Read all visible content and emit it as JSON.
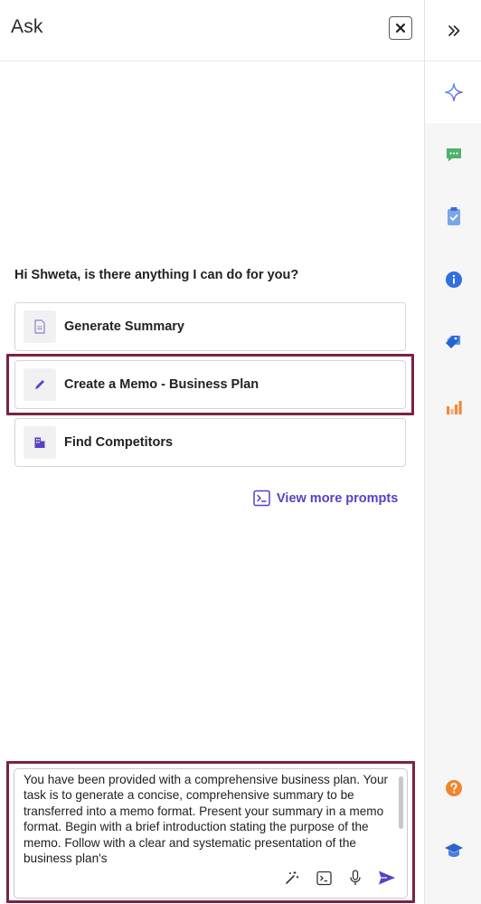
{
  "header": {
    "title": "Ask",
    "close_icon": "close-icon"
  },
  "greeting": "Hi Shweta, is there anything I can do for you?",
  "prompts": [
    {
      "label": "Generate Summary",
      "icon": "document-icon"
    },
    {
      "label": "Create a Memo - Business Plan",
      "icon": "pencil-icon"
    },
    {
      "label": "Find Competitors",
      "icon": "building-icon"
    }
  ],
  "view_more": {
    "label": "View more prompts",
    "icon": "terminal-prompt-icon"
  },
  "composer": {
    "text": "You have been provided with a comprehensive business plan. Your task is to generate a concise, comprehensive summary to be transferred into a memo format. Present your summary in a memo format. Begin with a brief introduction stating the purpose of the memo. Follow with a clear and systematic presentation of the business plan's",
    "tools": [
      "magic-wand-icon",
      "terminal-icon",
      "microphone-icon",
      "send-icon"
    ]
  },
  "rail": {
    "items": [
      "expand-icon",
      "sparkle-icon",
      "chat-icon",
      "clipboard-icon",
      "info-icon",
      "tag-icon",
      "bar-chart-icon",
      "help-icon",
      "graduation-cap-icon"
    ]
  },
  "colors": {
    "accent": "#5b3fc4",
    "highlight": "#7b2246",
    "chat_green": "#4cb36a",
    "clipboard_blue": "#7aa6e8",
    "info_blue": "#2f6fe0",
    "tag_blue": "#2563d6",
    "chart_orange": "#f08a3c",
    "help_orange": "#f0862c"
  }
}
